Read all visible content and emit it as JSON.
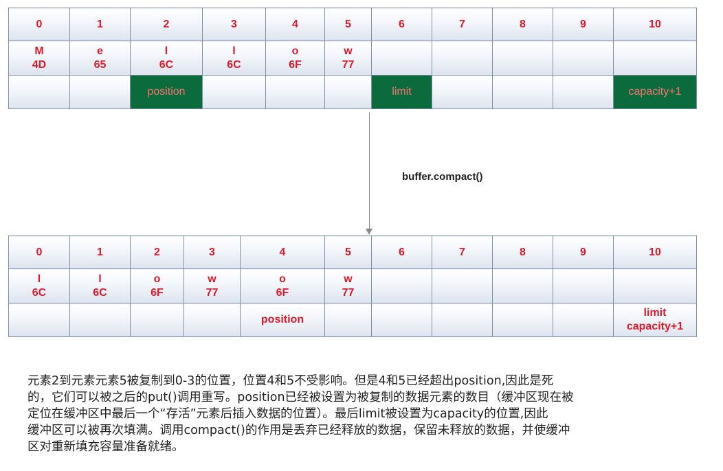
{
  "before": {
    "indices": [
      "0",
      "1",
      "2",
      "3",
      "4",
      "5",
      "6",
      "7",
      "8",
      "9",
      "10"
    ],
    "values": [
      {
        "char": "M",
        "hex": "4D"
      },
      {
        "char": "e",
        "hex": "65"
      },
      {
        "char": "l",
        "hex": "6C"
      },
      {
        "char": "l",
        "hex": "6C"
      },
      {
        "char": "o",
        "hex": "6F"
      },
      {
        "char": "w",
        "hex": "77"
      },
      {
        "char": "",
        "hex": ""
      },
      {
        "char": "",
        "hex": ""
      },
      {
        "char": "",
        "hex": ""
      },
      {
        "char": "",
        "hex": ""
      },
      {
        "char": "",
        "hex": ""
      }
    ],
    "markers": [
      "",
      "",
      "position",
      "",
      "",
      "",
      "limit",
      "",
      "",
      "",
      "capacity+1"
    ]
  },
  "operation": "buffer.compact()",
  "after": {
    "indices": [
      "0",
      "1",
      "2",
      "3",
      "4",
      "5",
      "6",
      "7",
      "8",
      "9",
      "10"
    ],
    "values": [
      {
        "char": "l",
        "hex": "6C"
      },
      {
        "char": "l",
        "hex": "6C"
      },
      {
        "char": "o",
        "hex": "6F"
      },
      {
        "char": "w",
        "hex": "77"
      },
      {
        "char": "o",
        "hex": "6F"
      },
      {
        "char": "w",
        "hex": "77"
      },
      {
        "char": "",
        "hex": ""
      },
      {
        "char": "",
        "hex": ""
      },
      {
        "char": "",
        "hex": ""
      },
      {
        "char": "",
        "hex": ""
      },
      {
        "char": "",
        "hex": ""
      }
    ],
    "markers": [
      {
        "line1": "",
        "line2": ""
      },
      {
        "line1": "",
        "line2": ""
      },
      {
        "line1": "",
        "line2": ""
      },
      {
        "line1": "",
        "line2": ""
      },
      {
        "line1": "position",
        "line2": ""
      },
      {
        "line1": "",
        "line2": ""
      },
      {
        "line1": "",
        "line2": ""
      },
      {
        "line1": "",
        "line2": ""
      },
      {
        "line1": "",
        "line2": ""
      },
      {
        "line1": "",
        "line2": ""
      },
      {
        "line1": "limit",
        "line2": "capacity+1"
      }
    ]
  },
  "description": [
    "元素2到元素元素5被复制到0-3的位置，位置4和5不受影响。但是4和5已经超出position,因此是死",
    "的，它们可以被之后的put()调用重写。position已经被设置为被复制的数据元素的数目（缓冲区现在被",
    "定位在缓冲区中最后一个“存活”元素后插入数据的位置）。最后limit被设置为capacity的位置,因此",
    "缓冲区可以被再次填满。调用compact()的作用是丢弃已经释放的数据，保留未释放的数据，并使缓冲",
    "区对重新填充容量准备就绪。"
  ],
  "colors": {
    "value_text": "#e0192b",
    "highlight_fill": "#0c6b3d",
    "highlight_text": "#ff6f6f",
    "grid_border": "#7f8fa6"
  }
}
